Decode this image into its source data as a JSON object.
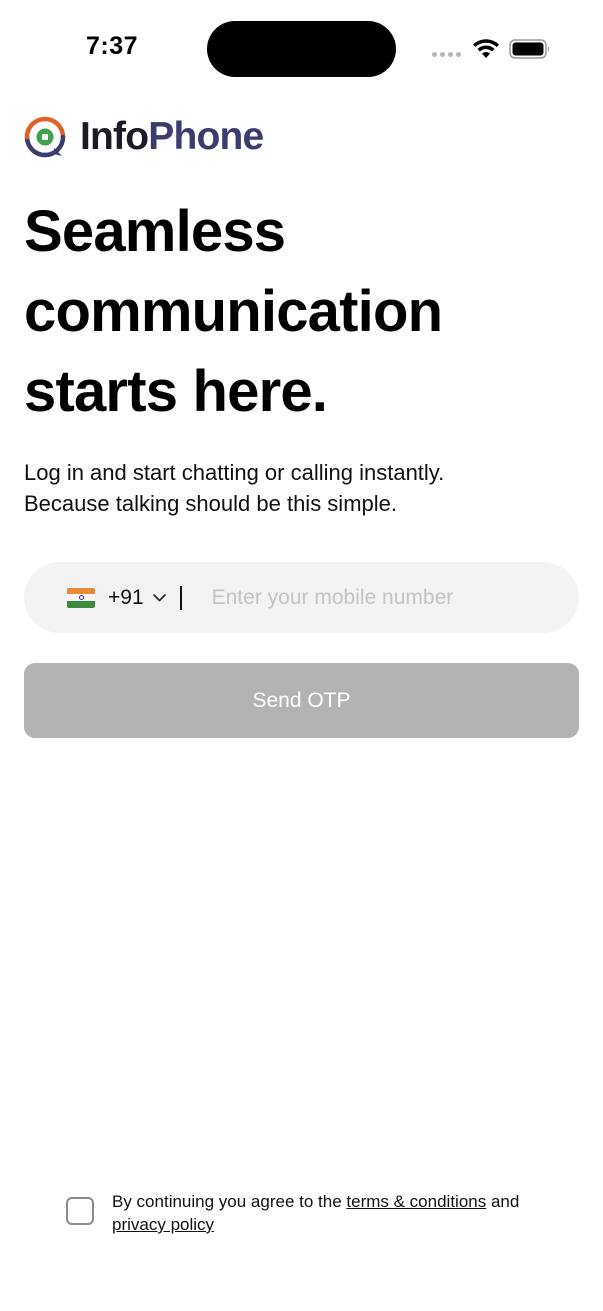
{
  "status_bar": {
    "time": "7:37"
  },
  "brand": {
    "name_part1": "Info",
    "name_part2": "Phone",
    "icon": "infophone-logo-icon",
    "colors": {
      "dark": "#1b1b26",
      "accent": "#3b3d6e",
      "logo_orange": "#e0612a",
      "logo_green": "#3fa34d",
      "logo_blue": "#3b3d6e"
    }
  },
  "headline": {
    "line1": "Seamless",
    "line2": "communication",
    "line3": "starts here."
  },
  "subtitle": {
    "line1": "Log in and start chatting or calling instantly.",
    "line2": "Because talking should be this simple."
  },
  "phone_input": {
    "country_flag": "india-flag-icon",
    "dial_code": "+91",
    "value": "",
    "placeholder": "Enter your mobile number"
  },
  "send_otp": {
    "label": "Send OTP",
    "enabled": false,
    "color": "#b3b3b3"
  },
  "terms": {
    "checked": false,
    "prefix": "By continuing you agree to the ",
    "terms_link": "terms & conditions",
    "middle": " and ",
    "privacy_link": "privacy policy"
  }
}
